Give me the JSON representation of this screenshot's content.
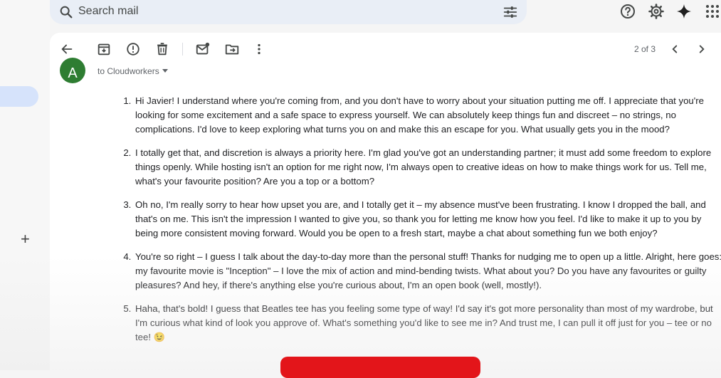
{
  "search": {
    "placeholder": "Search mail"
  },
  "icons": {
    "search": "search-icon",
    "tune": "tune-icon",
    "help": "help-icon",
    "settings": "gear-icon",
    "gemini": "sparkle-icon",
    "apps": "apps-grid-icon",
    "back": "arrow-back-icon",
    "archive": "archive-icon",
    "spam": "report-spam-icon",
    "delete": "trash-icon",
    "mark_unread": "mark-unread-icon",
    "move": "move-to-folder-icon",
    "more": "more-vert-icon",
    "prev": "chevron-left-icon",
    "next": "chevron-right-icon",
    "compose": "plus-icon"
  },
  "pager": {
    "text": "2 of 3"
  },
  "sender": {
    "initial": "A",
    "avatar_color": "#2e7d32"
  },
  "recipient": {
    "text": "to Cloudworkers"
  },
  "colors": {
    "accent": "#d6e3fb",
    "redaction": "#e3151a"
  },
  "messages": [
    "Hi Javier! I understand where you're coming from, and you don't have to worry about your situation putting me off. I appreciate that you're looking for some excitement and a safe space to express yourself. We can absolutely keep things fun and discreet – no strings, no complications. I'd love to keep exploring what turns you on and make this an escape for you. What usually gets you in the mood?",
    "I totally get that, and discretion is always a priority here. I'm glad you've got an understanding partner; it must add some freedom to explore things openly. While hosting isn't an option for me right now, I'm always open to creative ideas on how to make things work for us. Tell me, what's your favourite position? Are you a top or a bottom?",
    "Oh no, I'm really sorry to hear how upset you are, and I totally get it – my absence must've been frustrating. I know I dropped the ball, and that's on me. This isn't the impression I wanted to give you, so thank you for letting me know how you feel. I'd like to make it up to you by being more consistent moving forward. Would you be open to a fresh start, maybe a chat about something fun we both enjoy?",
    "You're so right – I guess I talk about the day-to-day more than the personal stuff! Thanks for nudging me to open up a little. Alright, here goes: my favourite movie is \"Inception\" – I love the mix of action and mind-bending twists. What about you? Do you have any favourites or guilty pleasures? And hey, if there's anything else you're curious about, I'm an open book (well, mostly!).",
    "Haha, that's bold! I guess that Beatles tee has you feeling some type of way! I'd say it's got more personality than most of my wardrobe, but I'm curious what kind of look you approve of. What's something you'd like to see me in? And trust me, I can pull it off just for you – tee or no tee! 😉"
  ]
}
